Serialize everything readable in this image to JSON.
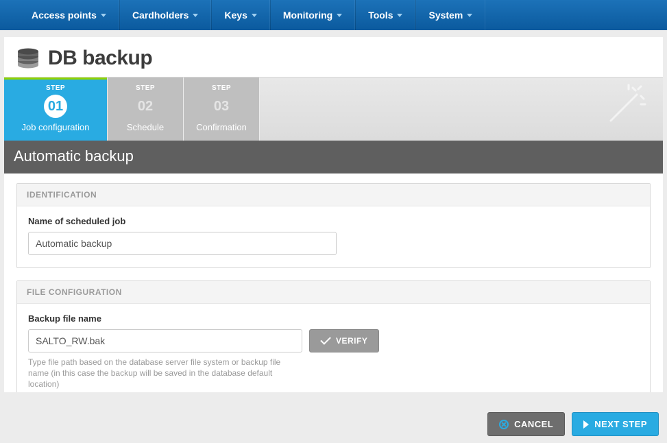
{
  "nav": {
    "items": [
      {
        "label": "Access points",
        "hasDropdown": true
      },
      {
        "label": "Cardholders",
        "hasDropdown": true
      },
      {
        "label": "Keys",
        "hasDropdown": true
      },
      {
        "label": "Monitoring",
        "hasDropdown": true
      },
      {
        "label": "Tools",
        "hasDropdown": true
      },
      {
        "label": "System",
        "hasDropdown": true
      }
    ]
  },
  "page": {
    "title": "DB backup",
    "section_title": "Automatic backup"
  },
  "wizard": {
    "step_label": "STEP",
    "steps": [
      {
        "num": "01",
        "name": "Job configuration",
        "active": true
      },
      {
        "num": "02",
        "name": "Schedule",
        "active": false
      },
      {
        "num": "03",
        "name": "Confirmation",
        "active": false
      }
    ]
  },
  "identification": {
    "panel_title": "IDENTIFICATION",
    "name_label": "Name of scheduled job",
    "name_value": "Automatic backup"
  },
  "file_config": {
    "panel_title": "FILE CONFIGURATION",
    "filename_label": "Backup file name",
    "filename_value": "SALTO_RW.bak",
    "verify_label": "VERIFY",
    "help_text": "Type file path based on the database server file system or backup file name (in this case the backup will be saved in the database default location)"
  },
  "footer": {
    "cancel_label": "CANCEL",
    "next_label": "NEXT STEP"
  },
  "colors": {
    "primary": "#29abe2",
    "nav": "#0b5a9e",
    "accent": "#8fd400"
  }
}
